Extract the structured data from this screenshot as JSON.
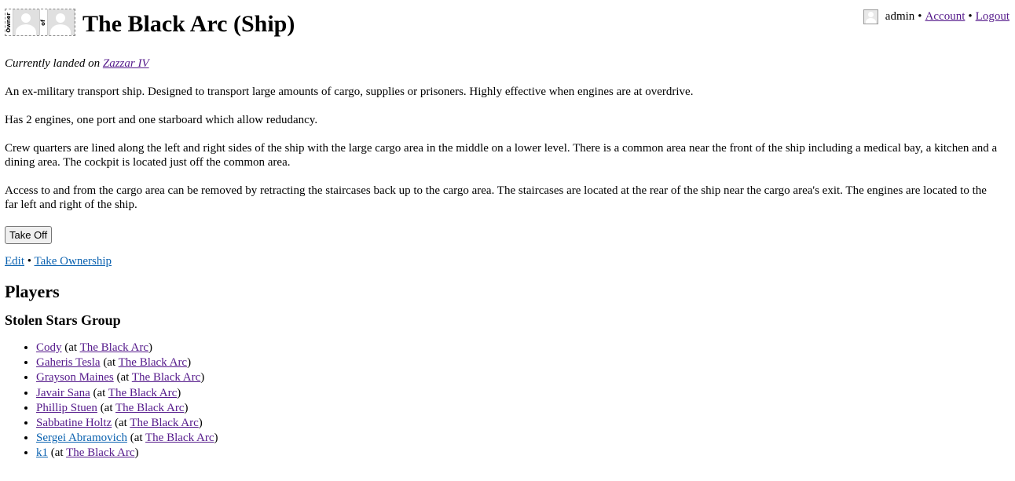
{
  "user_bar": {
    "username": "admin",
    "account": "Account",
    "logout": "Logout",
    "separator": "•"
  },
  "header": {
    "owner_label": "Owner",
    "of_label": "of",
    "title": "The Black Arc (Ship)"
  },
  "location": {
    "prefix": "Currently landed on ",
    "planet": "Zazzar IV"
  },
  "description": [
    "An ex-military transport ship. Designed to transport large amounts of cargo, supplies or prisoners. Highly effective when engines are at overdrive.",
    "Has 2 engines, one port and one starboard which allow redudancy.",
    "Crew quarters are lined along the left and right sides of the ship with the large cargo area in the middle on a lower level. There is a common area near the front of the ship including a medical bay, a kitchen and a dining area. The cockpit is located just off the common area.",
    "Access to and from the cargo area can be removed by retracting the staircases back up to the cargo area. The staircases are located at the rear of the ship near the cargo area's exit. The engines are located to the far left and right of the ship."
  ],
  "actions": {
    "take_off": "Take Off",
    "edit": "Edit",
    "take_ownership": "Take Ownership",
    "separator": "•"
  },
  "players": {
    "heading": "Players",
    "group": "Stolen Stars Group",
    "at_prefix": "(at ",
    "at_suffix": ")",
    "list": [
      {
        "name": "Cody",
        "location": "The Black Arc"
      },
      {
        "name": "Gaheris Tesla",
        "location": "The Black Arc"
      },
      {
        "name": "Grayson Maines",
        "location": "The Black Arc"
      },
      {
        "name": "Javair Sana",
        "location": "The Black Arc"
      },
      {
        "name": "Phillip Stuen",
        "location": "The Black Arc"
      },
      {
        "name": "Sabbatine Holtz",
        "location": "The Black Arc"
      },
      {
        "name": "Sergei Abramovich",
        "location": "The Black Arc"
      },
      {
        "name": "k1",
        "location": "The Black Arc"
      }
    ]
  },
  "colors": {
    "link_visited": "#551a8b",
    "link_unvisited": "#0b62b0"
  },
  "icons": {
    "user_avatar": "default-avatar-icon"
  }
}
